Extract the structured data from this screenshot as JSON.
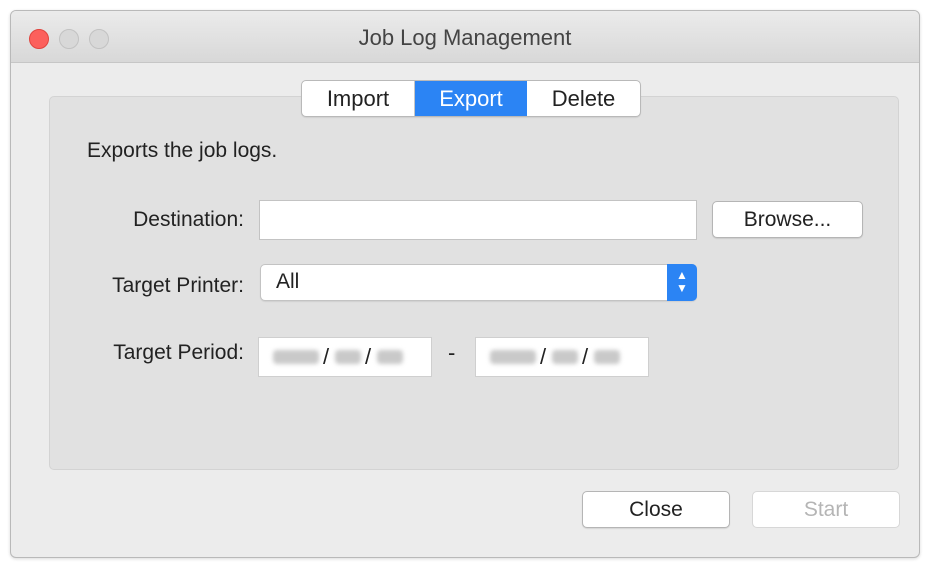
{
  "window": {
    "title": "Job Log Management"
  },
  "tabs": [
    {
      "label": "Import",
      "selected": false
    },
    {
      "label": "Export",
      "selected": true
    },
    {
      "label": "Delete",
      "selected": false
    }
  ],
  "export": {
    "description": "Exports the job logs.",
    "destination": {
      "label": "Destination:",
      "value": ""
    },
    "browse_label": "Browse...",
    "target_printer": {
      "label": "Target Printer:",
      "value": "All"
    },
    "target_period": {
      "label": "Target Period:",
      "separator": "-"
    }
  },
  "footer": {
    "close_label": "Close",
    "start_label": "Start",
    "start_enabled": false
  },
  "colors": {
    "accent": "#2b84f4",
    "close_light": "#fc605c"
  }
}
